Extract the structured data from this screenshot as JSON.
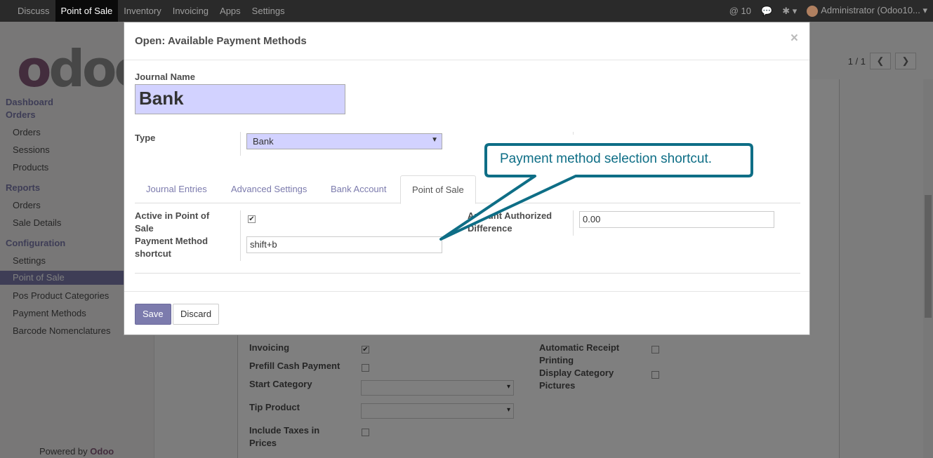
{
  "topbar": {
    "menus": [
      "Discuss",
      "Point of Sale",
      "Inventory",
      "Invoicing",
      "Apps",
      "Settings"
    ],
    "active_menu": "Point of Sale",
    "notifications": "10",
    "user": "Administrator (Odoo10..."
  },
  "sidebar": {
    "logo_text": "odoo",
    "sections": [
      {
        "label": "Dashboard"
      },
      {
        "label": "Orders",
        "items": [
          "Orders",
          "Sessions",
          "Products"
        ]
      },
      {
        "label": "Reports",
        "items": [
          "Orders",
          "Sale Details"
        ]
      },
      {
        "label": "Configuration",
        "items": [
          "Settings",
          "Point of Sale",
          "Pos Product Categories",
          "Payment Methods",
          "Barcode Nomenclatures"
        ]
      }
    ],
    "active_item": "Point of Sale",
    "powered_prefix": "Powered by ",
    "powered_brand": "Odoo"
  },
  "pager": {
    "value": "1 / 1"
  },
  "background_form": {
    "fields": [
      {
        "label": "Invoicing",
        "checked": true
      },
      {
        "label": "Prefill Cash Payment",
        "checked": false
      },
      {
        "label": "Start Category"
      },
      {
        "label": "Tip Product"
      },
      {
        "label": "Include Taxes in Prices",
        "checked": false
      }
    ],
    "right_fields": [
      {
        "label": "Automatic Receipt Printing",
        "checked": false
      },
      {
        "label": "Display Category Pictures",
        "checked": false
      }
    ]
  },
  "modal": {
    "title": "Open: Available Payment Methods",
    "close": "×",
    "journal_name_label": "Journal Name",
    "journal_name": "Bank",
    "type_label": "Type",
    "type_value": "Bank",
    "tabs": [
      "Journal Entries",
      "Advanced Settings",
      "Bank Account",
      "Point of Sale"
    ],
    "active_tab": "Point of Sale",
    "active_in_pos_label": "Active in Point of Sale",
    "active_in_pos": true,
    "shortcut_label": "Payment Method shortcut",
    "shortcut_value": "shift+b",
    "authorized_diff_label": "Amount Authorized Difference",
    "authorized_diff_value": "0.00",
    "save": "Save",
    "discard": "Discard"
  },
  "callout": {
    "text": "Payment method selection shortcut."
  },
  "colors": {
    "brand": "#875a7b",
    "accent": "#7c7bad",
    "callout": "#0e6e86",
    "highlight_field": "#d2d2ff"
  }
}
